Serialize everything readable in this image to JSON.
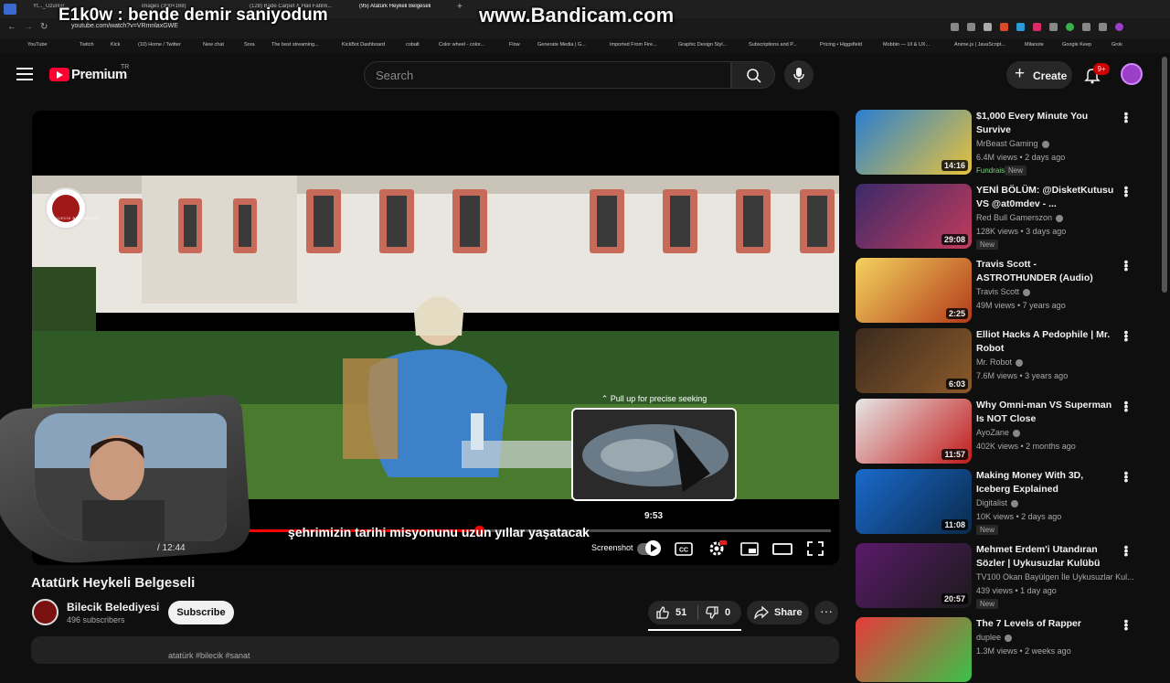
{
  "browser": {
    "tabs": [
      "Yt..._Uzunlar...",
      "images (300×168)",
      "(128) Bade Carpet & Hali Fabrik...",
      "(95) Atatürk Heykeli Belgeseli"
    ],
    "url": "youtube.com/watch?v=VRmnlaxGWE",
    "bookmarks": [
      "YouTube",
      "Twitch",
      "Kick",
      "(10) Home / Twitter",
      "New chat",
      "Sora",
      "The best streaming...",
      "KickBot Dashboard",
      "cobalt",
      "Color wheel - color...",
      "Flow",
      "Generate Media | G...",
      "Imported From Fire...",
      "Graphic Design Styl...",
      "Subscriptions and P...",
      "Pricing • Higgsfield",
      "Mobbin — UI & UX...",
      "Anime.js | JavaScript...",
      "Milanote",
      "Google Keep",
      "Grok"
    ]
  },
  "overlay": {
    "chat_message": "E1k0w : bende demir saniyodum",
    "watermark": "www.Bandicam.com"
  },
  "header": {
    "brand": "Premium",
    "region": "TR",
    "search_placeholder": "Search",
    "create_label": "Create",
    "notification_count": "9+"
  },
  "player": {
    "pull_up_hint": "Pull up for precise seeking",
    "preview_time": "9:53",
    "subtitle": "şehrimizin tarihi misyonunu uzun yıllar yaşatacak",
    "time_display": "/ 12:44",
    "screenshot_label": "Screenshot",
    "progress_fraction": 0.42,
    "seek_fraction": 0.71,
    "logo_caption": "BİLECİK BELEDİYESİ"
  },
  "video": {
    "title": "Atatürk Heykeli Belgeseli",
    "channel": "Bilecik Belediyesi",
    "subscribers": "496 subscribers",
    "subscribe_label": "Subscribe",
    "likes": "51",
    "dislikes": "0",
    "share_label": "Share",
    "description_peek": "atatürk #bilecik #sanat"
  },
  "recommendations": [
    {
      "title": "$1,000 Every Minute You Survive",
      "channel": "MrBeast Gaming",
      "views": "6.4M views • 2 days ago",
      "duration": "14:16",
      "badges": [
        "Fundraiser",
        "New"
      ],
      "colors": [
        "#2a7fd0",
        "#e8c23a"
      ]
    },
    {
      "title": "YENİ BÖLÜM: @DisketKutusu VS @at0mdev - ...",
      "channel": "Red Bull Gamerszon",
      "views": "128K views • 3 days ago",
      "duration": "29:08",
      "badges": [
        "New"
      ],
      "colors": [
        "#3a2a6a",
        "#c23a5a"
      ]
    },
    {
      "title": "Travis Scott - ASTROTHUNDER (Audio)",
      "channel": "Travis Scott",
      "views": "49M views • 7 years ago",
      "duration": "2:25",
      "badges": [],
      "colors": [
        "#f4d35e",
        "#b23a1a"
      ]
    },
    {
      "title": "Elliot Hacks A Pedophile | Mr. Robot",
      "channel": "Mr. Robot",
      "views": "7.6M views • 3 years ago",
      "duration": "6:03",
      "badges": [],
      "colors": [
        "#3b2a1e",
        "#8a5a2a"
      ]
    },
    {
      "title": "Why Omni-man VS Superman Is NOT Close",
      "channel": "AyoZane",
      "views": "402K views • 2 months ago",
      "duration": "11:57",
      "badges": [],
      "colors": [
        "#e6e6e6",
        "#c21a1a"
      ]
    },
    {
      "title": "Making Money With 3D, Iceberg Explained",
      "channel": "Digitalist",
      "views": "10K views • 2 days ago",
      "duration": "11:08",
      "badges": [
        "New"
      ],
      "colors": [
        "#1a6acb",
        "#0a2a4a"
      ]
    },
    {
      "title": "Mehmet Erdem'i Utandıran Sözler | Uykusuzlar Kulübü",
      "channel": "TV100 Okan Bayülgen İle Uykusuzlar Kul...",
      "views": "439 views • 1 day ago",
      "duration": "20:57",
      "badges": [
        "New"
      ],
      "colors": [
        "#5a1a6a",
        "#1a1a1a"
      ]
    },
    {
      "title": "The 7 Levels of Rapper",
      "channel": "duplee",
      "views": "1.3M views • 2 weeks ago",
      "duration": "",
      "badges": [],
      "colors": [
        "#e63a3a",
        "#3ac24a"
      ]
    }
  ],
  "icons": [
    "menu-icon",
    "search-icon",
    "mic-icon",
    "plus-icon",
    "bell-icon",
    "play-icon",
    "captions-icon",
    "settings-icon",
    "miniplayer-icon",
    "theater-icon",
    "fullscreen-icon",
    "like-icon",
    "dislike-icon",
    "share-icon",
    "more-icon",
    "verified-icon",
    "kebab-icon"
  ]
}
